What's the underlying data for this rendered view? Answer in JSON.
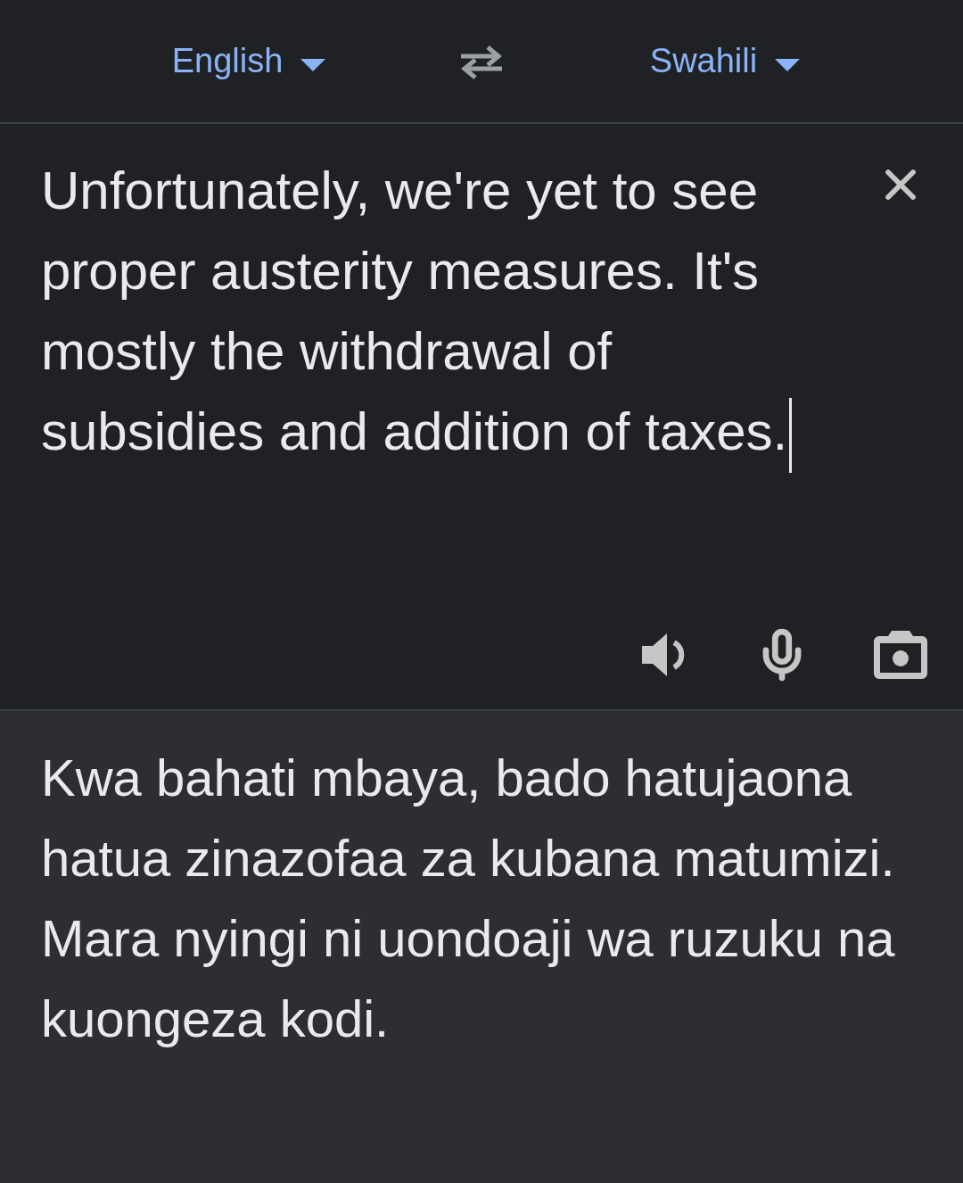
{
  "language_bar": {
    "source_language": "English",
    "target_language": "Swahili"
  },
  "input": {
    "value": "Unfortunately, we're yet to see proper austerity measures. It's mostly the withdrawal of subsidies and addition of taxes."
  },
  "translation": {
    "text": "Kwa bahati mbaya, bado hatujaona hatua zinazofaa za kubana matumizi. Mara nyingi ni uondoaji wa ruzuku na kuongeza kodi."
  }
}
